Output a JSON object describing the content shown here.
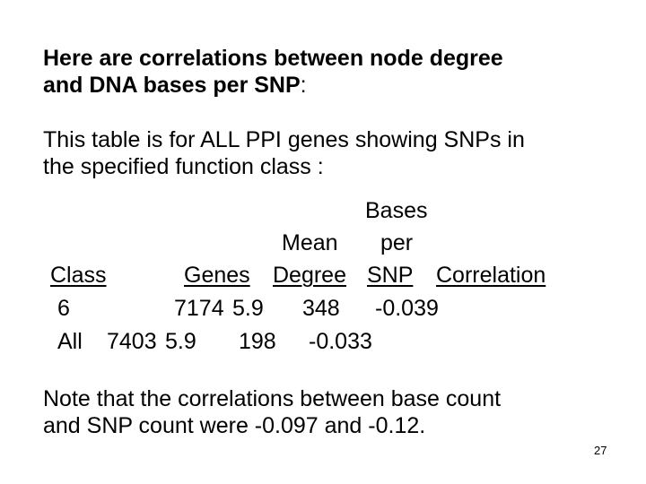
{
  "slide": {
    "heading": {
      "line1": "Here are correlations between node degree",
      "line2": "and DNA bases per SNP",
      "colon": ":"
    },
    "intro": {
      "line1": "This table is for ALL PPI genes showing SNPs in",
      "line2": "the specified function class :"
    },
    "table": {
      "header_top": {
        "bases": "Bases",
        "mean": "Mean",
        "per": "per"
      },
      "columns": [
        "Class",
        "Genes",
        "Degree",
        "SNP",
        "Correlation"
      ],
      "rows": [
        {
          "class": "6",
          "genes": "7174",
          "mean_degree": "5.9",
          "bases_per_snp": "348",
          "correlation": "-0.039"
        },
        {
          "class": "All",
          "genes": "7403",
          "mean_degree": "5.9",
          "bases_per_snp": "198",
          "correlation": "-0.033"
        }
      ]
    },
    "note": {
      "line1": "Note that the correlations between base count",
      "line2": "and SNP count were -0.097 and -0.12."
    },
    "page_number": "27"
  }
}
